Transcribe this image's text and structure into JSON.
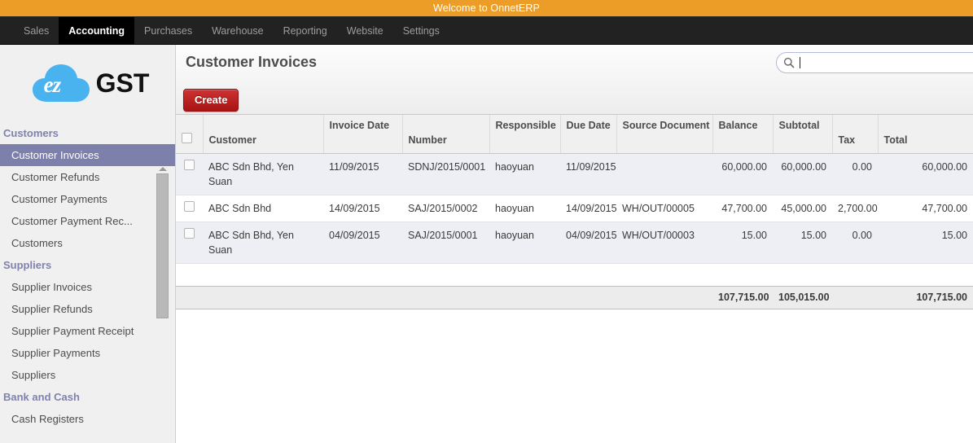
{
  "banner": {
    "text": "Welcome to OnnetERP"
  },
  "menu": {
    "items": [
      {
        "label": "Sales",
        "active": false
      },
      {
        "label": "Accounting",
        "active": true
      },
      {
        "label": "Purchases",
        "active": false
      },
      {
        "label": "Warehouse",
        "active": false
      },
      {
        "label": "Reporting",
        "active": false
      },
      {
        "label": "Website",
        "active": false
      },
      {
        "label": "Settings",
        "active": false
      }
    ]
  },
  "sidebar": {
    "logo": {
      "badge_text": "ez",
      "word": "GST",
      "cloud_color": "#49b3f0"
    },
    "groups": [
      {
        "title": "Customers",
        "items": [
          {
            "label": "Customer Invoices",
            "selected": true
          },
          {
            "label": "Customer Refunds",
            "selected": false
          },
          {
            "label": "Customer Payments",
            "selected": false
          },
          {
            "label": "Customer Payment Rec...",
            "selected": false
          },
          {
            "label": "Customers",
            "selected": false
          }
        ]
      },
      {
        "title": "Suppliers",
        "items": [
          {
            "label": "Supplier Invoices",
            "selected": false
          },
          {
            "label": "Supplier Refunds",
            "selected": false
          },
          {
            "label": "Supplier Payment Receipt",
            "selected": false
          },
          {
            "label": "Supplier Payments",
            "selected": false
          },
          {
            "label": "Suppliers",
            "selected": false
          }
        ]
      },
      {
        "title": "Bank and Cash",
        "items": [
          {
            "label": "Cash Registers",
            "selected": false
          }
        ]
      }
    ]
  },
  "main": {
    "page_title": "Customer Invoices",
    "create_label": "Create",
    "search": {
      "value": "",
      "placeholder": ""
    },
    "table": {
      "columns": [
        {
          "key": "customer",
          "label": "Customer",
          "align": "left",
          "valign": "bottom"
        },
        {
          "key": "invoice_date",
          "label": "Invoice Date",
          "align": "left",
          "valign": "top"
        },
        {
          "key": "number",
          "label": "Number",
          "align": "left",
          "valign": "bottom"
        },
        {
          "key": "responsible",
          "label": "Responsible",
          "align": "left",
          "valign": "top"
        },
        {
          "key": "due_date",
          "label": "Due Date",
          "align": "left",
          "valign": "top"
        },
        {
          "key": "source_document",
          "label": "Source Document",
          "align": "left",
          "valign": "top"
        },
        {
          "key": "balance",
          "label": "Balance",
          "align": "left",
          "valign": "top"
        },
        {
          "key": "subtotal",
          "label": "Subtotal",
          "align": "left",
          "valign": "top"
        },
        {
          "key": "tax",
          "label": "Tax",
          "align": "left",
          "valign": "bottom"
        },
        {
          "key": "total",
          "label": "Total",
          "align": "left",
          "valign": "bottom"
        }
      ],
      "rows": [
        {
          "customer": "ABC Sdn Bhd, Yen Suan",
          "invoice_date": "11/09/2015",
          "number": "SDNJ/2015/0001",
          "responsible": "haoyuan",
          "due_date": "11/09/2015",
          "source_document": "",
          "balance": "60,000.00",
          "subtotal": "60,000.00",
          "tax": "0.00",
          "total": "60,000.00"
        },
        {
          "customer": "ABC Sdn Bhd",
          "invoice_date": "14/09/2015",
          "number": "SAJ/2015/0002",
          "responsible": "haoyuan",
          "due_date": "14/09/2015",
          "source_document": "WH/OUT/00005",
          "balance": "47,700.00",
          "subtotal": "45,000.00",
          "tax": "2,700.00",
          "total": "47,700.00"
        },
        {
          "customer": "ABC Sdn Bhd, Yen Suan",
          "invoice_date": "04/09/2015",
          "number": "SAJ/2015/0001",
          "responsible": "haoyuan",
          "due_date": "04/09/2015",
          "source_document": "WH/OUT/00003",
          "balance": "15.00",
          "subtotal": "15.00",
          "tax": "0.00",
          "total": "15.00"
        }
      ],
      "totals": {
        "balance": "107,715.00",
        "subtotal": "105,015.00",
        "tax": "",
        "total": "107,715.00"
      }
    }
  }
}
